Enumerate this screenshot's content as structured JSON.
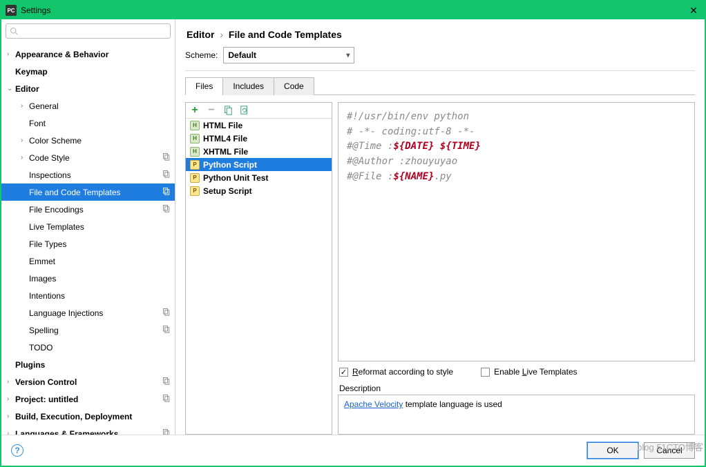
{
  "window": {
    "title": "Settings",
    "close": "✕",
    "app_icon": "PC"
  },
  "search": {
    "placeholder": ""
  },
  "sidebar": {
    "items": [
      {
        "label": "Appearance & Behavior",
        "bold": true,
        "chev": "›",
        "indent": 0
      },
      {
        "label": "Keymap",
        "bold": true,
        "chev": "",
        "indent": 0
      },
      {
        "label": "Editor",
        "bold": true,
        "chev": "⌄",
        "indent": 0
      },
      {
        "label": "General",
        "bold": false,
        "chev": "›",
        "indent": 1
      },
      {
        "label": "Font",
        "bold": false,
        "chev": "",
        "indent": 1
      },
      {
        "label": "Color Scheme",
        "bold": false,
        "chev": "›",
        "indent": 1
      },
      {
        "label": "Code Style",
        "bold": false,
        "chev": "›",
        "indent": 1,
        "copy": true
      },
      {
        "label": "Inspections",
        "bold": false,
        "chev": "",
        "indent": 1,
        "copy": true
      },
      {
        "label": "File and Code Templates",
        "bold": false,
        "chev": "",
        "indent": 1,
        "copy": true,
        "selected": true
      },
      {
        "label": "File Encodings",
        "bold": false,
        "chev": "",
        "indent": 1,
        "copy": true
      },
      {
        "label": "Live Templates",
        "bold": false,
        "chev": "",
        "indent": 1
      },
      {
        "label": "File Types",
        "bold": false,
        "chev": "",
        "indent": 1
      },
      {
        "label": "Emmet",
        "bold": false,
        "chev": "",
        "indent": 1
      },
      {
        "label": "Images",
        "bold": false,
        "chev": "",
        "indent": 1
      },
      {
        "label": "Intentions",
        "bold": false,
        "chev": "",
        "indent": 1
      },
      {
        "label": "Language Injections",
        "bold": false,
        "chev": "",
        "indent": 1,
        "copy": true
      },
      {
        "label": "Spelling",
        "bold": false,
        "chev": "",
        "indent": 1,
        "copy": true
      },
      {
        "label": "TODO",
        "bold": false,
        "chev": "",
        "indent": 1
      },
      {
        "label": "Plugins",
        "bold": true,
        "chev": "",
        "indent": 0
      },
      {
        "label": "Version Control",
        "bold": true,
        "chev": "›",
        "indent": 0,
        "copy": true
      },
      {
        "label": "Project: untitled",
        "bold": true,
        "chev": "›",
        "indent": 0,
        "copy": true
      },
      {
        "label": "Build, Execution, Deployment",
        "bold": true,
        "chev": "›",
        "indent": 0
      },
      {
        "label": "Languages & Frameworks",
        "bold": true,
        "chev": "›",
        "indent": 0,
        "copy": true
      }
    ]
  },
  "breadcrumb": {
    "p1": "Editor",
    "sep": "›",
    "p2": "File and Code Templates"
  },
  "scheme": {
    "label": "Scheme:",
    "value": "Default"
  },
  "tabs": [
    {
      "label": "Files",
      "active": true
    },
    {
      "label": "Includes"
    },
    {
      "label": "Code"
    }
  ],
  "templates": [
    {
      "label": "HTML File",
      "icon": "H",
      "cls": "ic-html"
    },
    {
      "label": "HTML4 File",
      "icon": "H",
      "cls": "ic-html"
    },
    {
      "label": "XHTML File",
      "icon": "H",
      "cls": "ic-html"
    },
    {
      "label": "Python Script",
      "icon": "P",
      "cls": "ic-py",
      "selected": true
    },
    {
      "label": "Python Unit Test",
      "icon": "P",
      "cls": "ic-py"
    },
    {
      "label": "Setup Script",
      "icon": "P",
      "cls": "ic-py"
    }
  ],
  "code": {
    "l1": "#!/usr/bin/env python",
    "l2": "# -*- coding:utf-8 -*-",
    "l3a": "#@Time      :",
    "l3v1": "${DATE}",
    "l3v2": "${TIME}",
    "l4a": "#@Author    :",
    "l4b": "zhouyuyao",
    "l5a": "#@File      :",
    "l5v": "${NAME}",
    "l5b": ".py"
  },
  "checks": {
    "reformat": "Reformat according to style",
    "r_pre": "R",
    "live": "Enable Live Templates",
    "l_pre": "L"
  },
  "desc": {
    "label": "Description",
    "link": "Apache Velocity",
    "rest": " template language is used"
  },
  "footer": {
    "ok": "OK",
    "cancel": "Cancel"
  },
  "watermark": "blog 51CTO博客"
}
